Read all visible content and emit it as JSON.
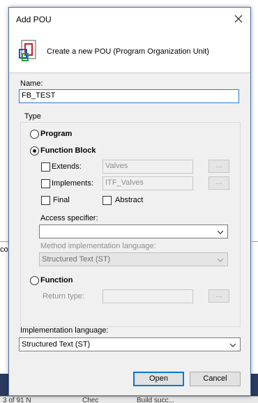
{
  "background": {
    "left_fragment": "co",
    "status_fragments": [
      "3 of 91 N",
      "Chec",
      "Build succ..."
    ]
  },
  "dialog": {
    "title": "Add POU",
    "header_text": "Create a new POU (Program Organization Unit)",
    "icons": {
      "close": "close-icon",
      "header": "pou-icon",
      "dropdown": "chevron-down-icon"
    },
    "name_label": "Name:",
    "name_value": "FB_TEST",
    "type_group_title": "Type",
    "program_label": "Program",
    "function_block_label": "Function Block",
    "selected_type": "Function Block",
    "extends_label": "Extends:",
    "extends_value": "Valves",
    "implements_label": "Implements:",
    "implements_value": "ITF_Valves",
    "browse_label": "...",
    "final_label": "Final",
    "abstract_label": "Abstract",
    "access_label": "Access specifier:",
    "access_value": "",
    "method_lang_label": "Method implementation language:",
    "method_lang_value": "Structured Text (ST)",
    "function_label": "Function",
    "return_type_label": "Return type:",
    "impl_lang_label": "Implementation language:",
    "impl_lang_value": "Structured Text (ST)",
    "open_label": "Open",
    "cancel_label": "Cancel"
  },
  "colors": {
    "focus_border": "#2a7bd4",
    "default_button_border": "#0078d7",
    "window_border": "#4b6fa8"
  }
}
